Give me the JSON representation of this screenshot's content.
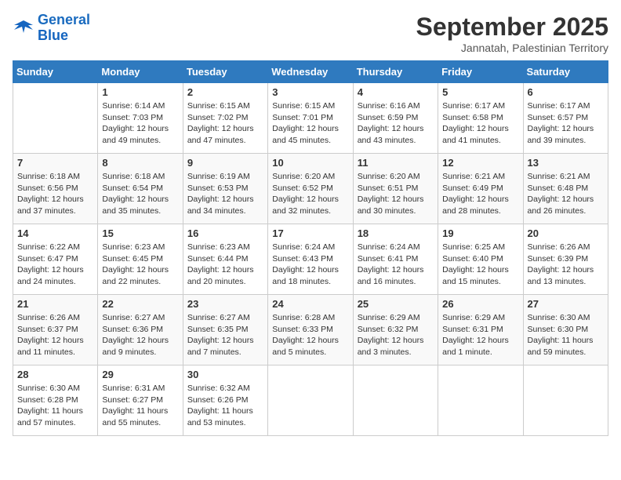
{
  "logo": {
    "text_general": "General",
    "text_blue": "Blue"
  },
  "header": {
    "month_year": "September 2025",
    "location": "Jannatah, Palestinian Territory"
  },
  "days_of_week": [
    "Sunday",
    "Monday",
    "Tuesday",
    "Wednesday",
    "Thursday",
    "Friday",
    "Saturday"
  ],
  "weeks": [
    [
      {
        "day": "",
        "sunrise": "",
        "sunset": "",
        "daylight": ""
      },
      {
        "day": "1",
        "sunrise": "Sunrise: 6:14 AM",
        "sunset": "Sunset: 7:03 PM",
        "daylight": "Daylight: 12 hours and 49 minutes."
      },
      {
        "day": "2",
        "sunrise": "Sunrise: 6:15 AM",
        "sunset": "Sunset: 7:02 PM",
        "daylight": "Daylight: 12 hours and 47 minutes."
      },
      {
        "day": "3",
        "sunrise": "Sunrise: 6:15 AM",
        "sunset": "Sunset: 7:01 PM",
        "daylight": "Daylight: 12 hours and 45 minutes."
      },
      {
        "day": "4",
        "sunrise": "Sunrise: 6:16 AM",
        "sunset": "Sunset: 6:59 PM",
        "daylight": "Daylight: 12 hours and 43 minutes."
      },
      {
        "day": "5",
        "sunrise": "Sunrise: 6:17 AM",
        "sunset": "Sunset: 6:58 PM",
        "daylight": "Daylight: 12 hours and 41 minutes."
      },
      {
        "day": "6",
        "sunrise": "Sunrise: 6:17 AM",
        "sunset": "Sunset: 6:57 PM",
        "daylight": "Daylight: 12 hours and 39 minutes."
      }
    ],
    [
      {
        "day": "7",
        "sunrise": "Sunrise: 6:18 AM",
        "sunset": "Sunset: 6:56 PM",
        "daylight": "Daylight: 12 hours and 37 minutes."
      },
      {
        "day": "8",
        "sunrise": "Sunrise: 6:18 AM",
        "sunset": "Sunset: 6:54 PM",
        "daylight": "Daylight: 12 hours and 35 minutes."
      },
      {
        "day": "9",
        "sunrise": "Sunrise: 6:19 AM",
        "sunset": "Sunset: 6:53 PM",
        "daylight": "Daylight: 12 hours and 34 minutes."
      },
      {
        "day": "10",
        "sunrise": "Sunrise: 6:20 AM",
        "sunset": "Sunset: 6:52 PM",
        "daylight": "Daylight: 12 hours and 32 minutes."
      },
      {
        "day": "11",
        "sunrise": "Sunrise: 6:20 AM",
        "sunset": "Sunset: 6:51 PM",
        "daylight": "Daylight: 12 hours and 30 minutes."
      },
      {
        "day": "12",
        "sunrise": "Sunrise: 6:21 AM",
        "sunset": "Sunset: 6:49 PM",
        "daylight": "Daylight: 12 hours and 28 minutes."
      },
      {
        "day": "13",
        "sunrise": "Sunrise: 6:21 AM",
        "sunset": "Sunset: 6:48 PM",
        "daylight": "Daylight: 12 hours and 26 minutes."
      }
    ],
    [
      {
        "day": "14",
        "sunrise": "Sunrise: 6:22 AM",
        "sunset": "Sunset: 6:47 PM",
        "daylight": "Daylight: 12 hours and 24 minutes."
      },
      {
        "day": "15",
        "sunrise": "Sunrise: 6:23 AM",
        "sunset": "Sunset: 6:45 PM",
        "daylight": "Daylight: 12 hours and 22 minutes."
      },
      {
        "day": "16",
        "sunrise": "Sunrise: 6:23 AM",
        "sunset": "Sunset: 6:44 PM",
        "daylight": "Daylight: 12 hours and 20 minutes."
      },
      {
        "day": "17",
        "sunrise": "Sunrise: 6:24 AM",
        "sunset": "Sunset: 6:43 PM",
        "daylight": "Daylight: 12 hours and 18 minutes."
      },
      {
        "day": "18",
        "sunrise": "Sunrise: 6:24 AM",
        "sunset": "Sunset: 6:41 PM",
        "daylight": "Daylight: 12 hours and 16 minutes."
      },
      {
        "day": "19",
        "sunrise": "Sunrise: 6:25 AM",
        "sunset": "Sunset: 6:40 PM",
        "daylight": "Daylight: 12 hours and 15 minutes."
      },
      {
        "day": "20",
        "sunrise": "Sunrise: 6:26 AM",
        "sunset": "Sunset: 6:39 PM",
        "daylight": "Daylight: 12 hours and 13 minutes."
      }
    ],
    [
      {
        "day": "21",
        "sunrise": "Sunrise: 6:26 AM",
        "sunset": "Sunset: 6:37 PM",
        "daylight": "Daylight: 12 hours and 11 minutes."
      },
      {
        "day": "22",
        "sunrise": "Sunrise: 6:27 AM",
        "sunset": "Sunset: 6:36 PM",
        "daylight": "Daylight: 12 hours and 9 minutes."
      },
      {
        "day": "23",
        "sunrise": "Sunrise: 6:27 AM",
        "sunset": "Sunset: 6:35 PM",
        "daylight": "Daylight: 12 hours and 7 minutes."
      },
      {
        "day": "24",
        "sunrise": "Sunrise: 6:28 AM",
        "sunset": "Sunset: 6:33 PM",
        "daylight": "Daylight: 12 hours and 5 minutes."
      },
      {
        "day": "25",
        "sunrise": "Sunrise: 6:29 AM",
        "sunset": "Sunset: 6:32 PM",
        "daylight": "Daylight: 12 hours and 3 minutes."
      },
      {
        "day": "26",
        "sunrise": "Sunrise: 6:29 AM",
        "sunset": "Sunset: 6:31 PM",
        "daylight": "Daylight: 12 hours and 1 minute."
      },
      {
        "day": "27",
        "sunrise": "Sunrise: 6:30 AM",
        "sunset": "Sunset: 6:30 PM",
        "daylight": "Daylight: 11 hours and 59 minutes."
      }
    ],
    [
      {
        "day": "28",
        "sunrise": "Sunrise: 6:30 AM",
        "sunset": "Sunset: 6:28 PM",
        "daylight": "Daylight: 11 hours and 57 minutes."
      },
      {
        "day": "29",
        "sunrise": "Sunrise: 6:31 AM",
        "sunset": "Sunset: 6:27 PM",
        "daylight": "Daylight: 11 hours and 55 minutes."
      },
      {
        "day": "30",
        "sunrise": "Sunrise: 6:32 AM",
        "sunset": "Sunset: 6:26 PM",
        "daylight": "Daylight: 11 hours and 53 minutes."
      },
      {
        "day": "",
        "sunrise": "",
        "sunset": "",
        "daylight": ""
      },
      {
        "day": "",
        "sunrise": "",
        "sunset": "",
        "daylight": ""
      },
      {
        "day": "",
        "sunrise": "",
        "sunset": "",
        "daylight": ""
      },
      {
        "day": "",
        "sunrise": "",
        "sunset": "",
        "daylight": ""
      }
    ]
  ]
}
